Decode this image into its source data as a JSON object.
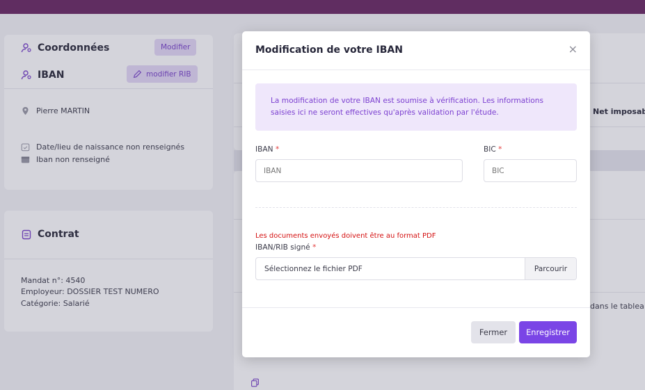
{
  "background": {
    "coordonnees": {
      "title": "Coordonnées",
      "edit_button": "Modifier",
      "iban_title": "IBAN",
      "rib_button": "modifier RIB",
      "person_name": "Pierre MARTIN",
      "birth_status": "Date/lieu de naissance non renseignés",
      "iban_status": "Iban non renseigné"
    },
    "contrat": {
      "title": "Contrat",
      "mandat": "Mandat n°: 4540",
      "employeur": "Employeur: DOSSIER TEST NUMERO",
      "categorie": "Catégorie: Salarié"
    },
    "right": {
      "net_imposable": "Net imposabl",
      "truncated_text": "dans le tablea"
    }
  },
  "modal": {
    "title": "Modification de votre IBAN",
    "close_glyph": "×",
    "alert_text": "La modification de votre IBAN est soumise à vérification. Les informations saisies ici ne seront effectives qu'après validation par l'étude.",
    "iban_label": "IBAN",
    "iban_placeholder": "IBAN",
    "bic_label": "BIC",
    "bic_placeholder": "BIC",
    "required_mark": "*",
    "pdf_warning": "Les documents envoyés doivent être au format PDF",
    "rib_label": "IBAN/RIB signé",
    "file_placeholder": "Sélectionnez le fichier PDF",
    "browse_label": "Parcourir",
    "close_label": "Fermer",
    "save_label": "Enregistrer"
  },
  "colors": {
    "topbar": "#6b2a63",
    "accent": "#7a45e6",
    "alert_bg": "#efe7fb",
    "required": "#e23b3b"
  },
  "icons": [
    "user-icon",
    "user-icon",
    "pencil-icon",
    "location-pin-icon",
    "calendar-check-icon",
    "wallet-icon",
    "clipboard-icon",
    "copy-icon",
    "close-icon"
  ]
}
